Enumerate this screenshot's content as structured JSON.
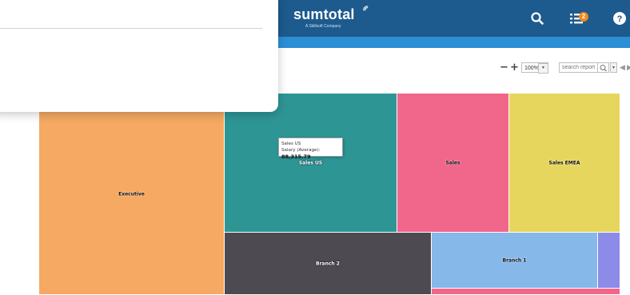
{
  "header": {
    "logo_text": "sumtotal",
    "logo_tagline": "A Skillsoft Company",
    "icons": [
      "search-icon",
      "tasks-icon",
      "help-icon"
    ],
    "notification_count": "2",
    "bar_color": "#1d5a8e",
    "subbar_color": "#2b8fd6"
  },
  "toolbar": {
    "zoom_out": "−",
    "zoom_in": "+",
    "zoom_value": "100%",
    "zoom_arrow": "▾",
    "search_placeholder": "search report",
    "search_arrow": "▾",
    "prev": "◀",
    "next": "▶"
  },
  "treemap": {
    "cells": [
      {
        "label": "Executive",
        "color": "#f5a962"
      },
      {
        "label": "Sales US",
        "color": "#2e9595"
      },
      {
        "label": "Sales",
        "color": "#f1668b"
      },
      {
        "label": "Sales EMEA",
        "color": "#e6d65e"
      },
      {
        "label": "Branch 2",
        "color": "#4d4b51"
      },
      {
        "label": "Branch 1",
        "color": "#87b8ea"
      },
      {
        "label": "",
        "color": "#8c8ce8"
      },
      {
        "label": "",
        "color": "#f1668b"
      }
    ]
  },
  "tooltip": {
    "title": "Sales US",
    "metric_label": "Salary (Average):",
    "metric_value": "88,315.79"
  }
}
